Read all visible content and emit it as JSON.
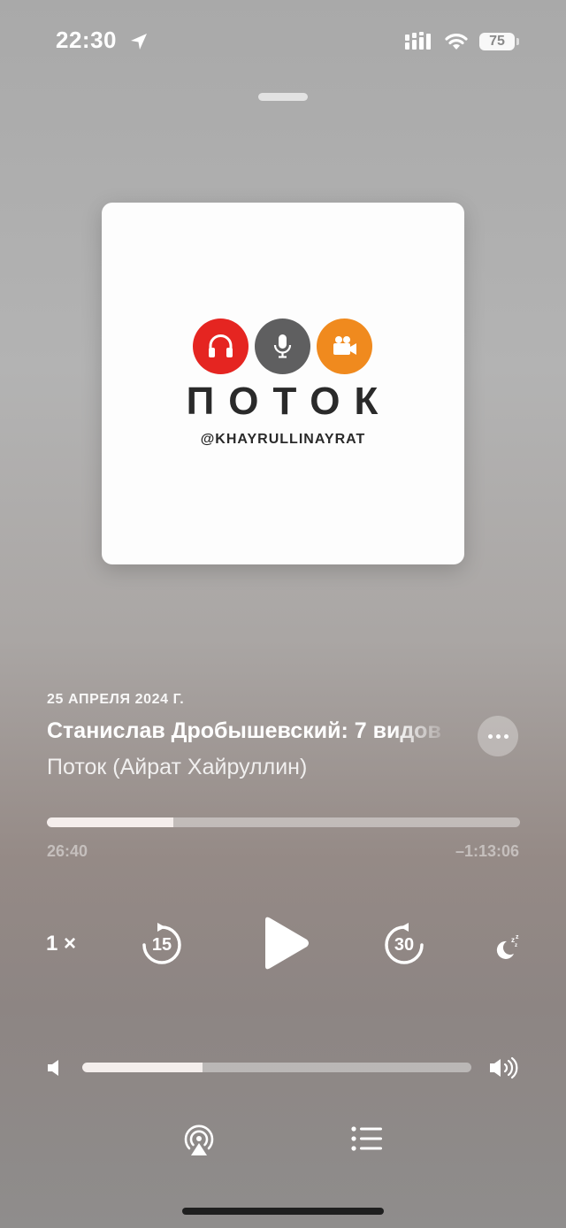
{
  "status_bar": {
    "time": "22:30",
    "location_icon": "location-arrow-icon",
    "signal_icon": "cellular-signal-icon",
    "wifi_icon": "wifi-icon",
    "battery_level": "75"
  },
  "artwork": {
    "title": "ПОТОК",
    "handle": "@KHAYRULLINAYRAT",
    "icons": [
      "headphones-icon",
      "microphone-icon",
      "video-camera-icon"
    ],
    "colors": {
      "red": "#e52521",
      "gray": "#5f5f60",
      "orange": "#f08a1e"
    }
  },
  "episode": {
    "date": "25 АПРЕЛЯ 2024 Г.",
    "title": "Станислав Дробышевский: 7 видов",
    "podcast": "Поток (Айрат Хайруллин)"
  },
  "progress": {
    "elapsed": "26:40",
    "remaining": "–1:13:06",
    "fraction": 0.267
  },
  "controls": {
    "speed_label": "1 ×",
    "skip_back_seconds": "15",
    "skip_forward_seconds": "30"
  },
  "volume": {
    "level": 0.31
  }
}
